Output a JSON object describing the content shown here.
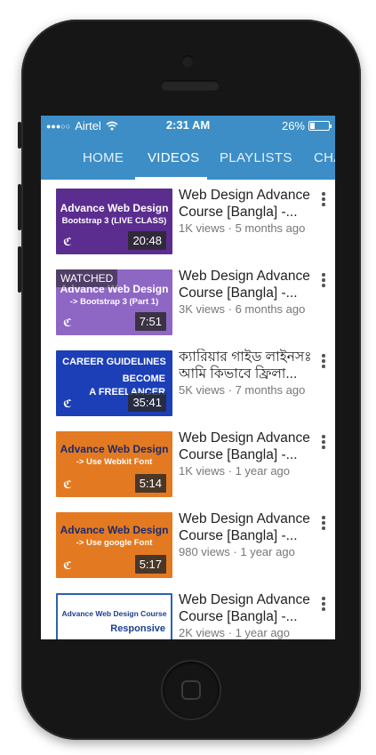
{
  "status_bar": {
    "signal_dots": "●●●○○",
    "carrier": "Airtel",
    "time": "2:31 AM",
    "battery": "26%",
    "battery_level": 0.26
  },
  "tabs": [
    {
      "label": "HOME",
      "active": false
    },
    {
      "label": "VIDEOS",
      "active": true
    },
    {
      "label": "PLAYLISTS",
      "active": false
    },
    {
      "label": "CHA",
      "active": false
    }
  ],
  "videos": [
    {
      "thumb_text": [
        "Advance Web Design",
        "Bootstrap 3 (LIVE CLASS)"
      ],
      "thumb_bg": "#5b2d8f",
      "duration": "20:48",
      "watched": "",
      "title": "Web Design Advance Course [Bangla] -...",
      "meta": "1K views · 5 months ago"
    },
    {
      "thumb_text": [
        "Advance Web Design",
        "-> Bootstrap 3 (Part 1)"
      ],
      "thumb_bg": "#8e67c4",
      "duration": "7:51",
      "watched": "WATCHED",
      "title": "Web Design Advance Course [Bangla] -...",
      "meta": "3K views · 6 months ago"
    },
    {
      "thumb_text": [
        "CAREER GUIDELINES",
        "BECOME",
        "A FREELANCER"
      ],
      "thumb_bg": "#1c3fb8",
      "duration": "35:41",
      "watched": "",
      "title": "ক্যারিয়ার গাইড লাইনসঃ আমি কিভাবে ফ্রিলা...",
      "meta": "5K views · 7 months ago"
    },
    {
      "thumb_text": [
        "Advance Web Design",
        "-> Use Webkit Font"
      ],
      "thumb_bg": "#e37a22",
      "duration": "5:14",
      "watched": "",
      "title": "Web Design Advance Course [Bangla] -...",
      "meta": "1K views · 1 year ago"
    },
    {
      "thumb_text": [
        "Advance Web Design",
        "-> Use google Font"
      ],
      "thumb_bg": "#e37a22",
      "duration": "5:17",
      "watched": "",
      "title": "Web Design Advance Course [Bangla] -...",
      "meta": "980 views · 1 year ago"
    },
    {
      "thumb_text": [
        "Advance Web Design Course",
        "Responsive"
      ],
      "thumb_bg": "#ffffff",
      "duration": "",
      "watched": "",
      "title": "Web Design Advance Course [Bangla] -...",
      "meta": "2K views · 1 year ago"
    }
  ],
  "colors": {
    "app_bar": "#3d8ec6",
    "phone_body": "#161616"
  }
}
